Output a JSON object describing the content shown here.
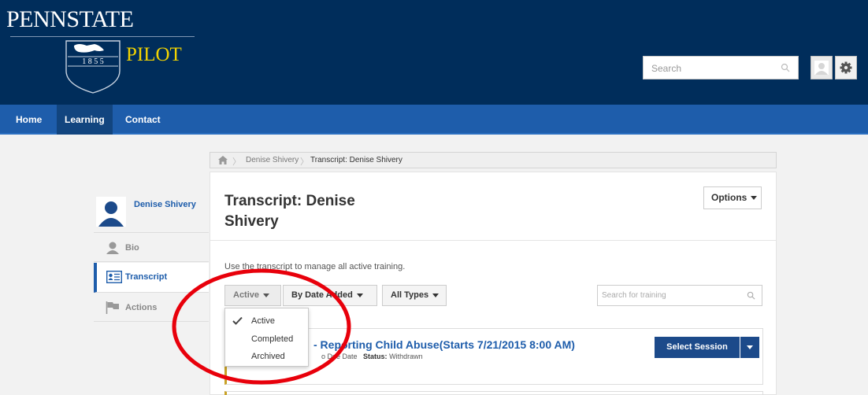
{
  "header": {
    "logo_penn": "PENNSTATE",
    "logo_year": "1 8 5 5",
    "logo_pilot": "PILOT",
    "search_placeholder": "Search"
  },
  "nav": {
    "items": [
      "Home",
      "Learning",
      "Contact"
    ],
    "active": "Learning"
  },
  "breadcrumb": {
    "items": [
      "Denise Shivery",
      "Transcript: Denise Shivery"
    ]
  },
  "profile": {
    "name": "Denise Shivery"
  },
  "sidebar": {
    "items": [
      {
        "label": "Bio",
        "icon": "person-icon"
      },
      {
        "label": "Transcript",
        "icon": "transcript-icon"
      },
      {
        "label": "Actions",
        "icon": "flag-icon"
      }
    ],
    "active": "Transcript"
  },
  "main": {
    "title": "Transcript: Denise Shivery",
    "options_label": "Options",
    "description": "Use the transcript to manage all active training.",
    "filters": {
      "status": "Active",
      "sort": "By Date Added",
      "types": "All Types"
    },
    "training_search_placeholder": "Search for training"
  },
  "status_dropdown": {
    "options": [
      "Active",
      "Completed",
      "Archived"
    ],
    "selected": "Active"
  },
  "training": {
    "title": "- Reporting Child Abuse(Starts 7/21/2015 8:00 AM)",
    "due_label": "o Due Date",
    "status_label": "Status:",
    "status_value": "Withdrawn",
    "action_label": "Select Session"
  },
  "colors": {
    "header_bg": "#002d5b",
    "nav_bg": "#1e5dab",
    "link_blue": "#1e5dab",
    "button_blue": "#1c4a8a",
    "annotation_red": "#e8000b",
    "pilot_yellow": "#f2d300"
  }
}
